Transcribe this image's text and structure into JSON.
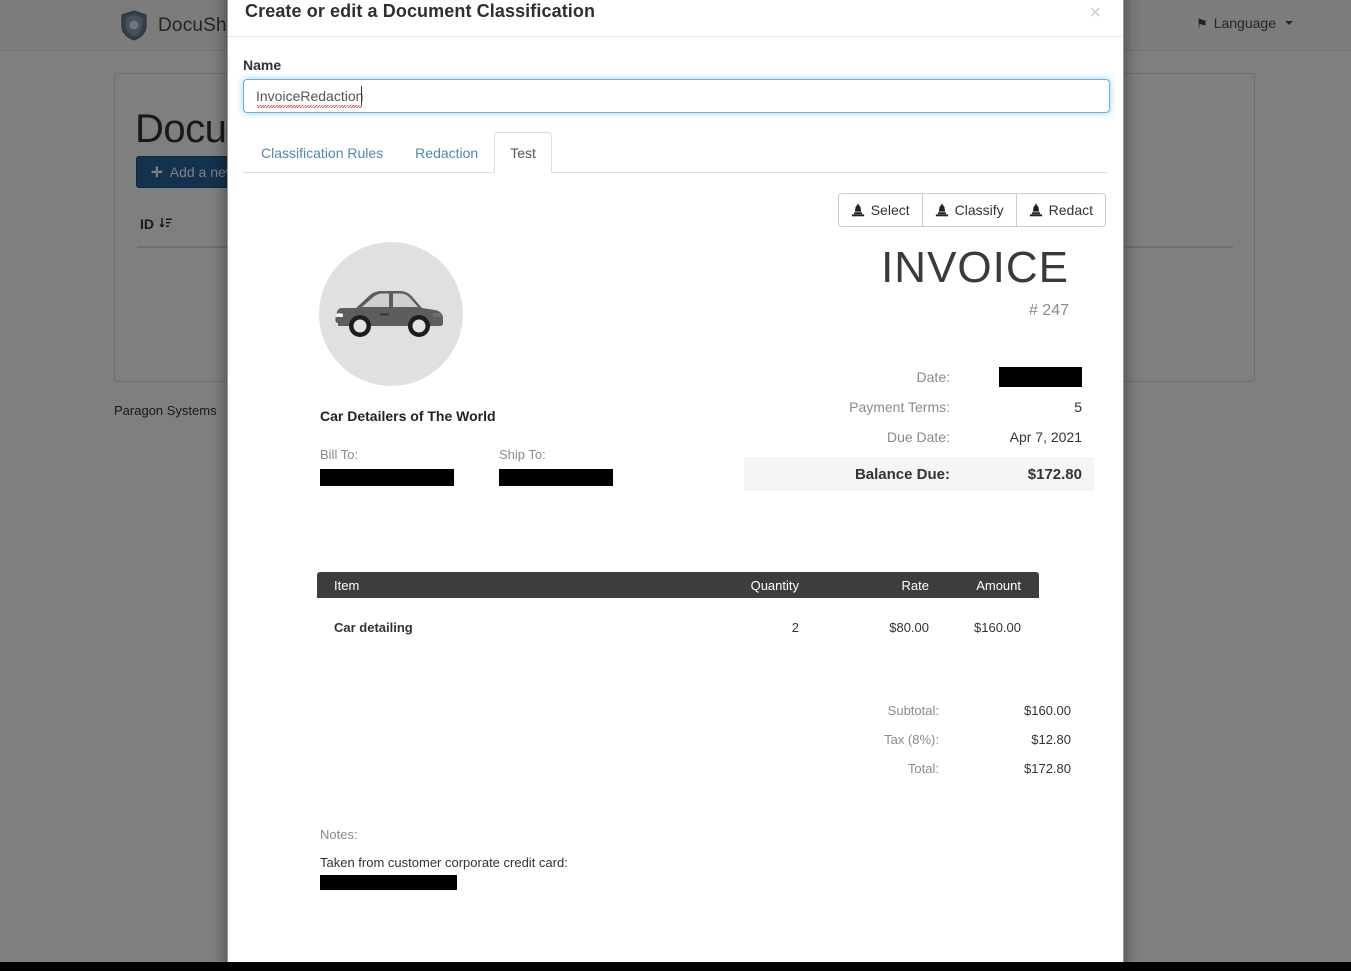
{
  "background": {
    "navbar": {
      "logo_icon": "shield-logo-icon",
      "brand": "DocuSh",
      "language_label": "Language",
      "flag_icon": "flag-icon",
      "caret_icon": "chevron-down-icon"
    },
    "page_title": "Docum",
    "add_button": "Add a new",
    "add_icon": "plus-icon",
    "table_header_id": "ID",
    "sort_icon": "sort-desc-icon",
    "footer": "Paragon Systems"
  },
  "modal": {
    "title": "Create or edit a Document Classification",
    "close_icon": "close-icon",
    "name_label": "Name",
    "name_value": "InvoiceRedaction",
    "name_placeholder": "Name",
    "tabs": [
      {
        "label": "Classification Rules",
        "active": false
      },
      {
        "label": "Redaction",
        "active": false
      },
      {
        "label": "Test",
        "active": true
      }
    ],
    "toolbar": [
      {
        "label": "Select",
        "icon": "gavel-icon"
      },
      {
        "label": "Classify",
        "icon": "gavel-icon"
      },
      {
        "label": "Redact",
        "icon": "gavel-icon"
      }
    ]
  },
  "invoice": {
    "logo_icon": "car-icon",
    "title": "INVOICE",
    "number": "# 247",
    "company": "Car Detailers of The World",
    "bill_to_label": "Bill To:",
    "bill_to_value": "",
    "ship_to_label": "Ship To:",
    "ship_to_value": "",
    "meta": [
      {
        "label": "Date:",
        "value": "",
        "redacted": true
      },
      {
        "label": "Payment Terms:",
        "value": "5",
        "redacted": false
      },
      {
        "label": "Due Date:",
        "value": "Apr 7, 2021",
        "redacted": false
      }
    ],
    "balance_label": "Balance Due:",
    "balance_value": "$172.80",
    "table": {
      "columns": [
        "Item",
        "Quantity",
        "Rate",
        "Amount"
      ],
      "rows": [
        {
          "item": "Car detailing",
          "quantity": "2",
          "rate": "$80.00",
          "amount": "$160.00"
        }
      ]
    },
    "totals": [
      {
        "label": "Subtotal:",
        "value": "$160.00"
      },
      {
        "label": "Tax (8%):",
        "value": "$12.80"
      },
      {
        "label": "Total:",
        "value": "$172.80"
      }
    ],
    "notes_label": "Notes:",
    "notes_text": "Taken from customer corporate credit card:",
    "notes_redacted": ""
  },
  "colors": {
    "primary_button": "#27649b",
    "tab_link": "#4c8ca8",
    "table_header": "#3d3d3d",
    "redaction": "#000000",
    "focus_ring": "#66afe9"
  }
}
